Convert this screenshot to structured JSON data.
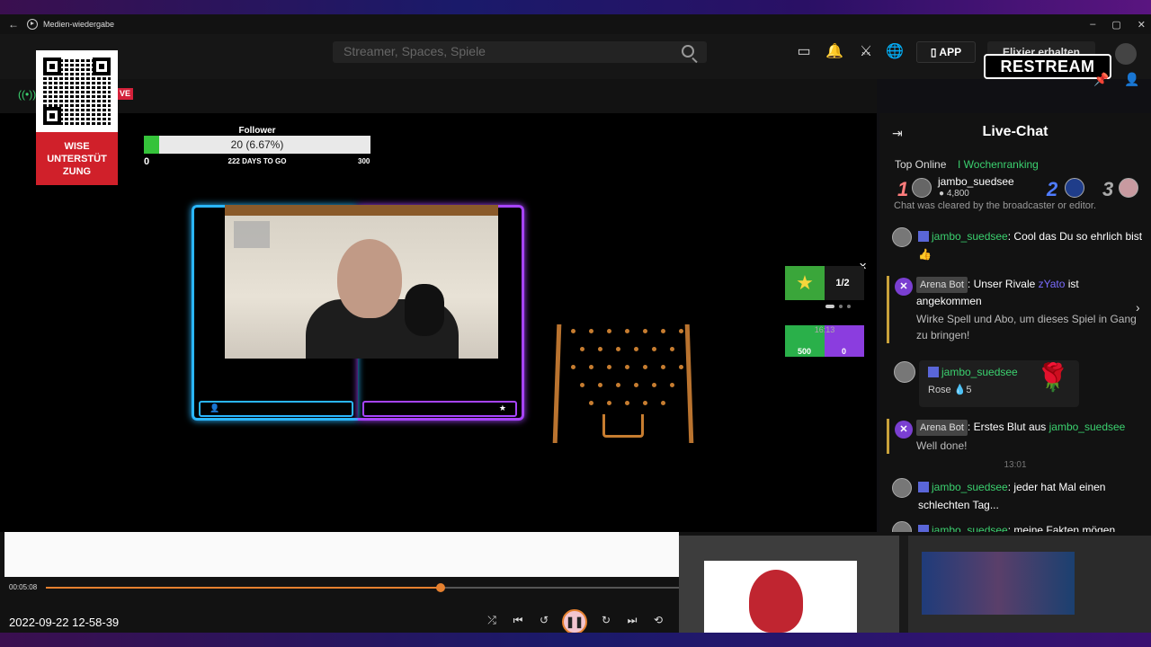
{
  "titlebar": {
    "back_glyph": "←",
    "app_title": "Medien-wiedergabe",
    "controls": [
      "–",
      "▢",
      "✕"
    ]
  },
  "header": {
    "search_placeholder": "Streamer, Spaces, Spiele",
    "app_button": "▯ APP",
    "elixier_button": "Elixier erhalten",
    "restream_logo": "RESTREAM",
    "icons": [
      "message-icon",
      "bell-icon",
      "x-icon",
      "globe-icon"
    ]
  },
  "subheader": {
    "signal_glyph": "((•))",
    "live_badge": "VE",
    "pin_glyph": "📌",
    "user_glyph": "👤"
  },
  "qr_card": {
    "label": "WISE UNTERSTÜT ZUNG"
  },
  "stream": {
    "follower_goal": {
      "title": "Follower",
      "text": "20 (6.67%)",
      "current": 20,
      "goal": 300,
      "percent": 6.67,
      "min_label": "0",
      "days_label": "222 DAYS TO GO",
      "max_label": "300"
    },
    "stat_card": {
      "count": "1/2",
      "close": "✕"
    },
    "duel": {
      "time": "16:13",
      "left": "500",
      "right": "0"
    }
  },
  "chat": {
    "title": "Live-Chat",
    "tabs": [
      "Top Online",
      "I Wochenranking"
    ],
    "ranking": {
      "first_rank": "1",
      "first_name": "jambo_suedsee",
      "first_points": "● 4,800",
      "second_rank": "2",
      "third_rank": "3"
    },
    "system_message": "Chat was cleared by the broadcaster or editor.",
    "messages": [
      {
        "user": "jambo_suedsee",
        "text": ": Cool das Du so ehrlich bist 👍"
      },
      {
        "user": "jambo_suedsee",
        "text": ": jeder hat Mal einen schlechten Tag..."
      },
      {
        "user": "jambo_suedsee",
        "text": ": meine Fakten mögen"
      }
    ],
    "bot1": {
      "tag": "Arena Bot",
      "text": ": Unser Rivale ",
      "rival": "zYato",
      "text2": " ist angekommen",
      "sub": "Wirke Spell und Abo, um dieses Spiel in Gang zu bringen!"
    },
    "gift": {
      "user": "jambo_suedsee",
      "text": "Rose 💧5",
      "rose": "🌹"
    },
    "bot2": {
      "tag": "Arena Bot",
      "text": ": Erstes Blut aus ",
      "user": "jambo_suedsee",
      "sub": "Well done!"
    },
    "time_separator": "13:01"
  },
  "player": {
    "elapsed": "00:05:08",
    "progress": 0.61,
    "filename": "2022-09-22 12-58-39",
    "controls": {
      "shuffle": "⤮",
      "prev": "⏮",
      "rewind": "↺",
      "play_pause": "❚❚",
      "forward": "↻",
      "next": "⏭",
      "repeat": "⟲"
    }
  },
  "colors": {
    "accent_green": "#3bd16f",
    "accent_orange": "#e5802f",
    "live_red": "#d4213a",
    "frame_blue": "#2ab6ff",
    "frame_purple": "#a744ff"
  }
}
